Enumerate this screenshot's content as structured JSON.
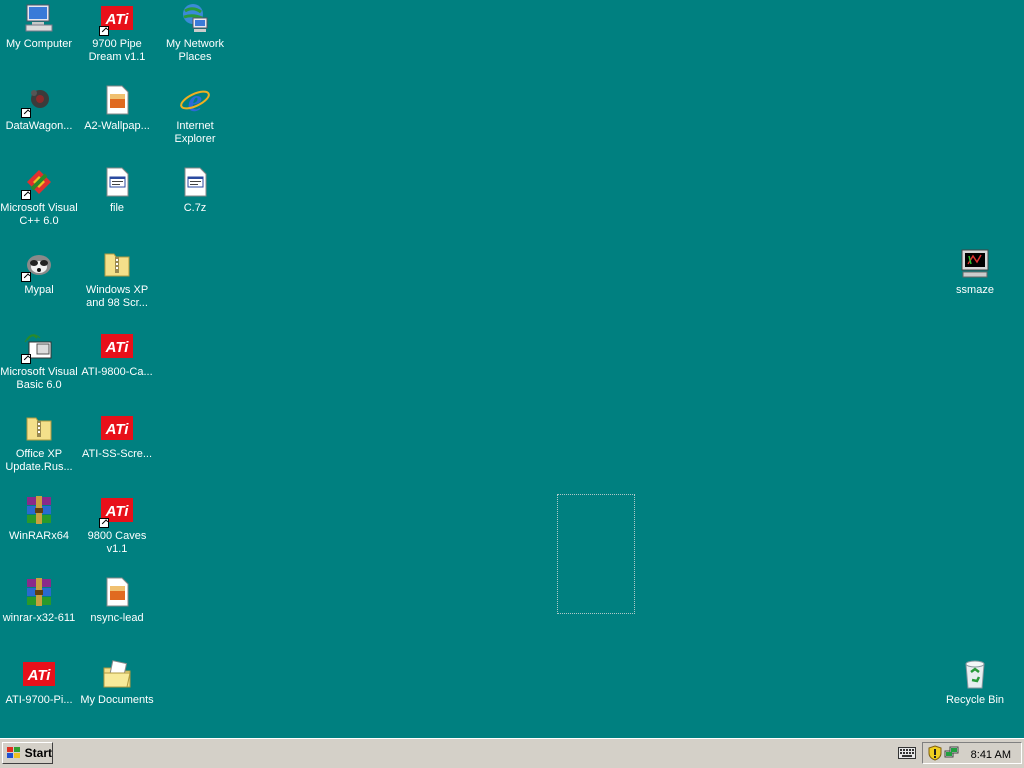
{
  "desktop": {
    "icons": [
      {
        "label": "My Computer",
        "icon": "my-computer-icon"
      },
      {
        "label": "9700 Pipe Dream v1.1",
        "icon": "ati-icon"
      },
      {
        "label": "My Network Places",
        "icon": "network-places-icon"
      },
      {
        "label": "DataWagon...",
        "icon": "datawagon-icon"
      },
      {
        "label": "A2-Wallpap...",
        "icon": "image-file-icon"
      },
      {
        "label": "Internet Explorer",
        "icon": "internet-explorer-icon"
      },
      {
        "label": "Microsoft Visual C++ 6.0",
        "icon": "visual-cpp-icon"
      },
      {
        "label": "file",
        "icon": "file-icon"
      },
      {
        "label": "C.7z",
        "icon": "file-icon"
      },
      {
        "label": "Mypal",
        "icon": "mypal-icon"
      },
      {
        "label": "Windows XP and 98 Scr...",
        "icon": "zip-folder-icon"
      },
      {
        "label": "Microsoft Visual Basic 6.0",
        "icon": "visual-basic-icon"
      },
      {
        "label": "ATI-9800-Ca...",
        "icon": "ati-icon"
      },
      {
        "label": "Office XP Update.Rus...",
        "icon": "zip-folder-icon"
      },
      {
        "label": "ATI-SS-Scre...",
        "icon": "ati-icon"
      },
      {
        "label": "WinRARx64",
        "icon": "winrar-icon"
      },
      {
        "label": "9800 Caves v1.1",
        "icon": "ati-icon"
      },
      {
        "label": "winrar-x32-611",
        "icon": "winrar-icon"
      },
      {
        "label": "nsync-lead",
        "icon": "image-file-icon"
      },
      {
        "label": "ATI-9700-Pi...",
        "icon": "ati-icon"
      },
      {
        "label": "My Documents",
        "icon": "my-documents-icon"
      },
      {
        "label": "ssmaze",
        "icon": "screensaver-icon"
      },
      {
        "label": "Recycle Bin",
        "icon": "recycle-bin-icon"
      }
    ],
    "ati_text": "ATi"
  },
  "taskbar": {
    "start_label": "Start",
    "clock": "8:41 AM",
    "tray_icons": [
      "keyboard-icon",
      "security-shield-icon",
      "network-connection-icon"
    ]
  },
  "colors": {
    "desktop": "#008080",
    "taskbar": "#d4d0c8",
    "ati_red": "#e8101a"
  }
}
